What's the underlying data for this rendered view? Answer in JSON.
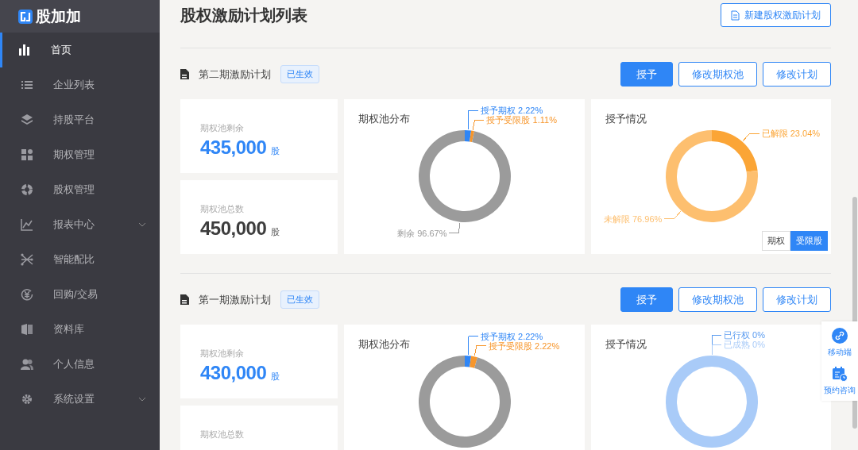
{
  "brand": {
    "name": "股加加"
  },
  "sidebar": {
    "items": [
      {
        "label": "首页",
        "selected": true,
        "has_submenu": false
      },
      {
        "label": "企业列表",
        "selected": false,
        "has_submenu": false
      },
      {
        "label": "持股平台",
        "selected": false,
        "has_submenu": false
      },
      {
        "label": "期权管理",
        "selected": false,
        "has_submenu": false
      },
      {
        "label": "股权管理",
        "selected": false,
        "has_submenu": false
      },
      {
        "label": "报表中心",
        "selected": false,
        "has_submenu": true
      },
      {
        "label": "智能配比",
        "selected": false,
        "has_submenu": false
      },
      {
        "label": "回购/交易",
        "selected": false,
        "has_submenu": false
      },
      {
        "label": "资料库",
        "selected": false,
        "has_submenu": false
      },
      {
        "label": "个人信息",
        "selected": false,
        "has_submenu": false
      },
      {
        "label": "系统设置",
        "selected": false,
        "has_submenu": true
      }
    ]
  },
  "page": {
    "title": "股权激励计划列表",
    "new_button": "新建股权激励计划"
  },
  "plans": [
    {
      "title": "第二期激励计划",
      "status": "已生效",
      "buttons": [
        {
          "label": "授予",
          "primary": true
        },
        {
          "label": "修改期权池",
          "primary": false
        },
        {
          "label": "修改计划",
          "primary": false
        }
      ],
      "stats": [
        {
          "label": "期权池剩余",
          "value": "435,000",
          "unit": "股",
          "highlight": true
        },
        {
          "label": "期权池总数",
          "value": "450,000",
          "unit": "股",
          "highlight": false
        }
      ],
      "pool_chart": {
        "chart_data": {
          "type": "donut",
          "title": "期权池分布",
          "categories": [
            "授予期权",
            "授予受限股",
            "剩余"
          ],
          "values": [
            2.22,
            1.11,
            96.67
          ],
          "colors": [
            "#2f86f6",
            "#f7962b",
            "#9b9b9b"
          ],
          "value_labels": [
            "2.22%",
            "1.11%",
            "96.67%"
          ]
        }
      },
      "grant_chart": {
        "chart_data": {
          "type": "donut",
          "title": "授予情况",
          "categories": [
            "已解限",
            "未解限"
          ],
          "values": [
            23.04,
            76.96
          ],
          "colors": [
            "#fba536",
            "#fdbf6f"
          ],
          "value_labels": [
            "23.04%",
            "76.96%"
          ]
        },
        "toggle": [
          {
            "label": "期权",
            "selected": false
          },
          {
            "label": "受限股",
            "selected": true
          }
        ]
      }
    },
    {
      "title": "第一期激励计划",
      "status": "已生效",
      "buttons": [
        {
          "label": "授予",
          "primary": true
        },
        {
          "label": "修改期权池",
          "primary": false
        },
        {
          "label": "修改计划",
          "primary": false
        }
      ],
      "stats": [
        {
          "label": "期权池剩余",
          "value": "430,000",
          "unit": "股",
          "highlight": true
        },
        {
          "label": "期权池总数"
        }
      ],
      "pool_chart": {
        "chart_data": {
          "type": "donut",
          "title": "期权池分布",
          "categories": [
            "授予期权",
            "授予受限股",
            null
          ],
          "values": [
            2.22,
            2.22,
            95.56
          ],
          "colors": [
            "#2f86f6",
            "#f7962b",
            "#9b9b9b"
          ],
          "value_labels": [
            "2.22%",
            "2.22%",
            null
          ]
        }
      },
      "grant_chart": {
        "kind": "ring",
        "title": "授予情况",
        "labels": [
          {
            "label": "已行权",
            "value": "0%",
            "color": "#5b9cf0"
          },
          {
            "label": "已成熟",
            "value": "0%",
            "color": "#a9cbf8"
          }
        ]
      }
    }
  ],
  "float_panel": [
    {
      "label": "移动端",
      "kind": "link"
    },
    {
      "label": "预约咨询",
      "kind": "calendar"
    }
  ]
}
